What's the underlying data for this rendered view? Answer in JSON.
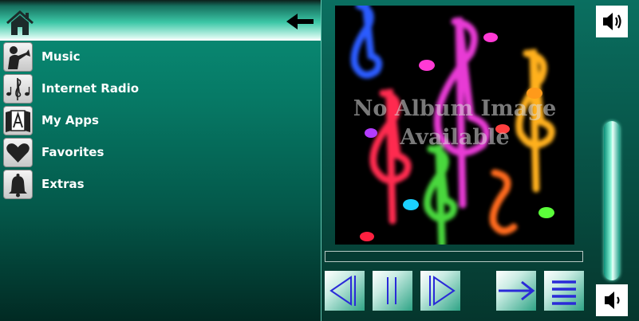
{
  "nav": {
    "home_icon": "home-icon",
    "back_icon": "back-arrow-icon",
    "items": [
      {
        "label": "Music",
        "icon": "trumpet-player-icon"
      },
      {
        "label": "Internet Radio",
        "icon": "music-notes-icon"
      },
      {
        "label": "My Apps",
        "icon": "apps-book-icon"
      },
      {
        "label": "Favorites",
        "icon": "heart-icon"
      },
      {
        "label": "Extras",
        "icon": "bell-icon"
      }
    ]
  },
  "player": {
    "album_placeholder_line1": "No Album Image",
    "album_placeholder_line2": "Available",
    "progress": 0,
    "controls": [
      "previous-icon",
      "pause-icon",
      "next-icon",
      "forward-arrow-icon",
      "menu-icon"
    ],
    "volume_level": 1.0
  },
  "colors": {
    "accent": "#2fb894",
    "control_glyph": "#2a2ad8"
  }
}
